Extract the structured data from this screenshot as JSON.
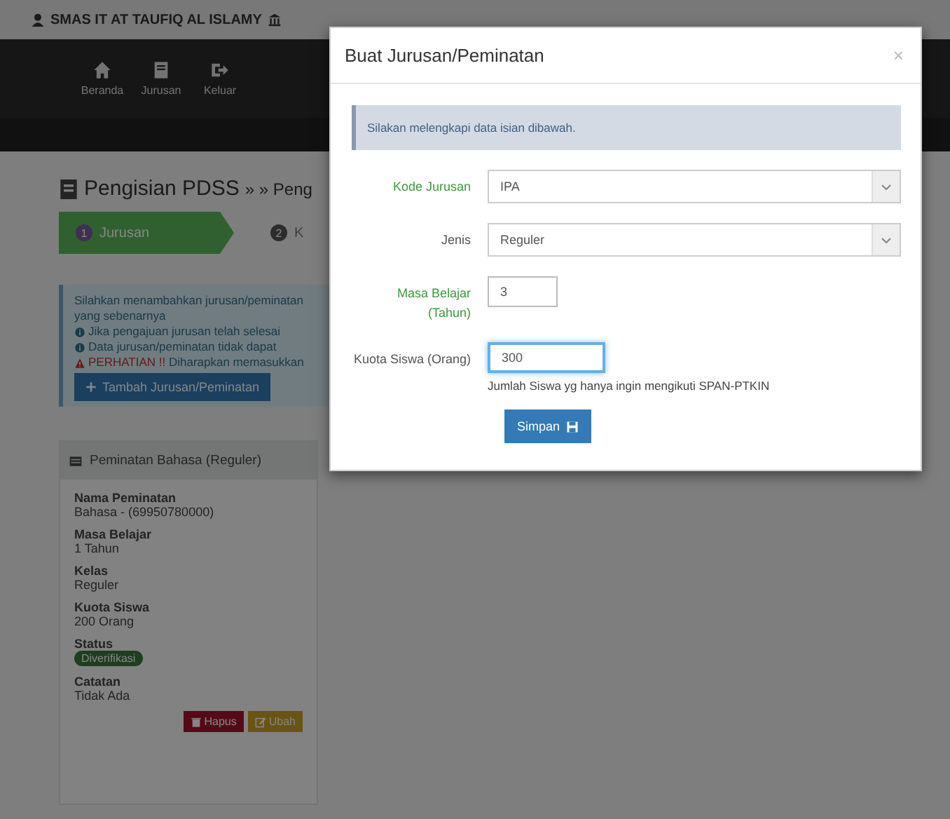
{
  "topbar": {
    "school": "SMAS IT AT TAUFIQ AL ISLAMY"
  },
  "nav": [
    {
      "label": "Beranda"
    },
    {
      "label": "Jurusan"
    },
    {
      "label": "Keluar"
    }
  ],
  "page": {
    "title": "Pengisian PDSS",
    "breadcrumb": "» » Peng",
    "steps": [
      {
        "number": "1",
        "label": "Jurusan",
        "selected": true
      },
      {
        "number": "2",
        "label": "K",
        "selected": false
      }
    ],
    "alert": {
      "lines": [
        {
          "kind": "text",
          "text": "Silahkan menambahkan jurusan/peminatan"
        },
        {
          "kind": "text",
          "text": "yang sebenarnya"
        },
        {
          "kind": "info",
          "text": "Jika pengajuan jurusan telah selesai"
        },
        {
          "kind": "info",
          "text": "Data jurusan/peminatan tidak dapat"
        },
        {
          "kind": "warning",
          "strong": "PERHATIAN !!",
          "text": "Diharapkan memasukkan"
        }
      ],
      "button": "Tambah Jurusan/Peminatan"
    },
    "card": {
      "title": "Peminatan Bahasa (Reguler)",
      "fields": [
        {
          "label": "Nama Peminatan",
          "value": "Bahasa - (69950780000)",
          "kind": "text"
        },
        {
          "label": "Masa Belajar",
          "value": "1 Tahun",
          "kind": "text"
        },
        {
          "label": "Kelas",
          "value": "Reguler",
          "kind": "text"
        },
        {
          "label": "Kuota Siswa",
          "value": "200 Orang",
          "kind": "text"
        },
        {
          "label": "Status",
          "value": "Diverifikasi",
          "kind": "badge"
        },
        {
          "label": "Catatan",
          "value": "Tidak Ada",
          "kind": "text"
        }
      ],
      "actions": [
        {
          "label": "Hapus",
          "kind": "delete"
        },
        {
          "label": "Ubah",
          "kind": "edit"
        }
      ]
    }
  },
  "modal": {
    "title": "Buat Jurusan/Peminatan",
    "close": "×",
    "info": "Silakan melengkapi data isian dibawah.",
    "fields": [
      {
        "kind": "select",
        "label": "Kode Jurusan",
        "value": "IPA",
        "valid": true,
        "focused": false
      },
      {
        "kind": "select",
        "label": "Jenis",
        "value": "Reguler",
        "valid": false,
        "focused": false
      },
      {
        "kind": "input",
        "label": "Masa Belajar (Tahun)",
        "value": "3",
        "valid": true,
        "focused": false
      },
      {
        "kind": "input",
        "label": "Kuota Siswa (Orang)",
        "value": "300",
        "valid": false,
        "focused": true,
        "help": "Jumlah Siswa yg hanya ingin mengikuti SPAN-PTKIN"
      }
    ],
    "submit": "Simpan"
  }
}
